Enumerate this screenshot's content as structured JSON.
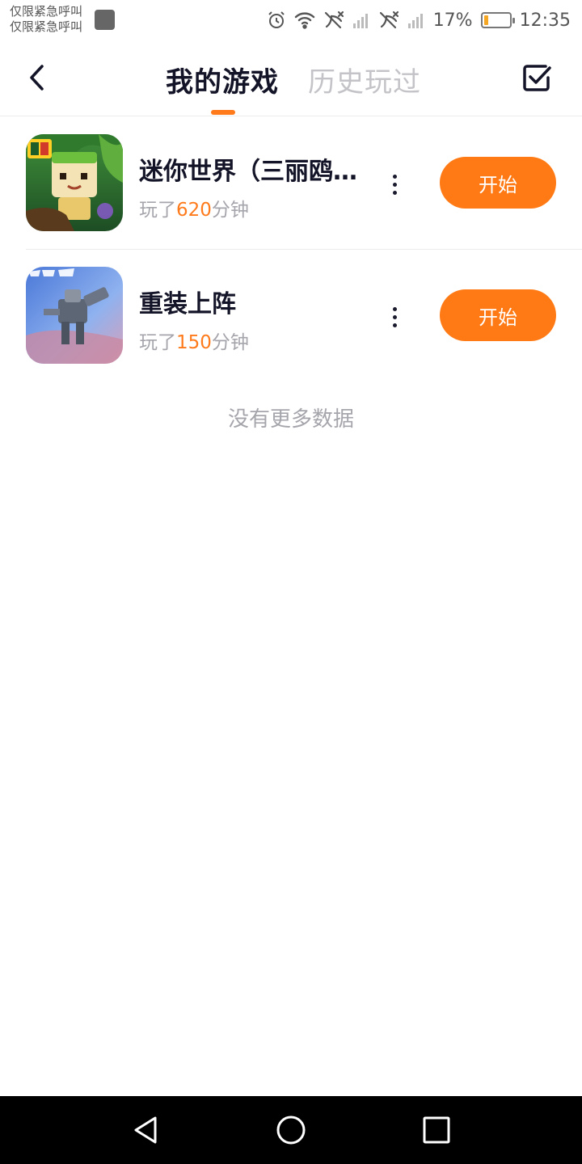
{
  "status_bar": {
    "carrier_line1": "仅限紧急呼叫",
    "carrier_line2": "仅限紧急呼叫",
    "battery_percent": "17%",
    "battery_level": 0.17,
    "time": "12:35",
    "icons": [
      "alarm-icon",
      "wifi-icon",
      "no-signal-icon",
      "signal-bars-icon",
      "no-signal-icon",
      "signal-bars-icon",
      "battery-icon"
    ]
  },
  "header": {
    "tab_active": "我的游戏",
    "tab_inactive": "历史玩过",
    "icons": [
      "back-arrow-icon",
      "checkbox-icon"
    ]
  },
  "games": [
    {
      "title": "迷你世界（三丽鸥...",
      "played_prefix": "玩了",
      "minutes": "620",
      "played_suffix": "分钟",
      "start_label": "开始"
    },
    {
      "title": "重装上阵",
      "played_prefix": "玩了",
      "minutes": "150",
      "played_suffix": "分钟",
      "start_label": "开始"
    }
  ],
  "footer_text": "没有更多数据",
  "nav": {
    "icons": [
      "back-triangle-icon",
      "home-circle-icon",
      "recents-square-icon"
    ]
  },
  "colors": {
    "accent": "#ff7a14",
    "title": "#141428",
    "muted": "#a5a5ac"
  }
}
